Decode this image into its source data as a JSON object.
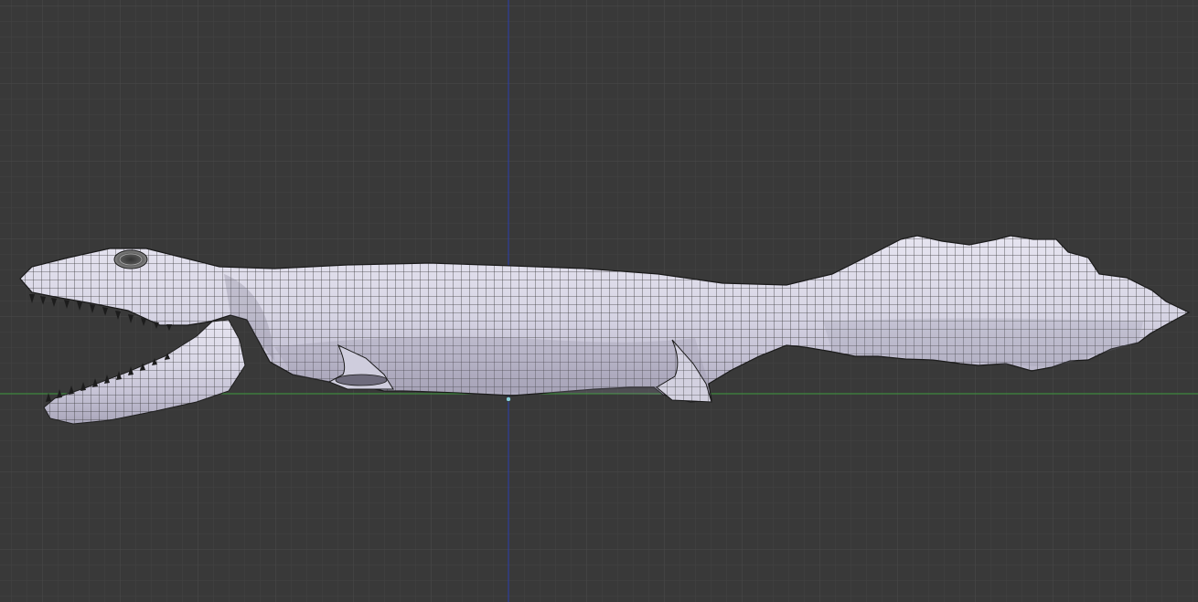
{
  "viewport": {
    "view": "orthographic-side",
    "shading": "solid-with-wireframe",
    "grid": true,
    "colors": {
      "background": "#393939",
      "grid_minor": "#434343",
      "grid_major": "#4d4d4d",
      "x_axis": "#3f9a3f",
      "z_axis": "#2b3fb0",
      "mesh_fill": "#d9d7e6",
      "mesh_shade": "#b5b2c4",
      "wire": "#2a2a2a",
      "teeth": "#1c1c1c",
      "origin_dot": "#8ad0d8"
    }
  },
  "scene": {
    "object": "crocodile-mesh",
    "parts": [
      "head",
      "jaw",
      "teeth",
      "eye",
      "body",
      "front-leg",
      "hind-leg",
      "tail",
      "tail-fin"
    ]
  }
}
